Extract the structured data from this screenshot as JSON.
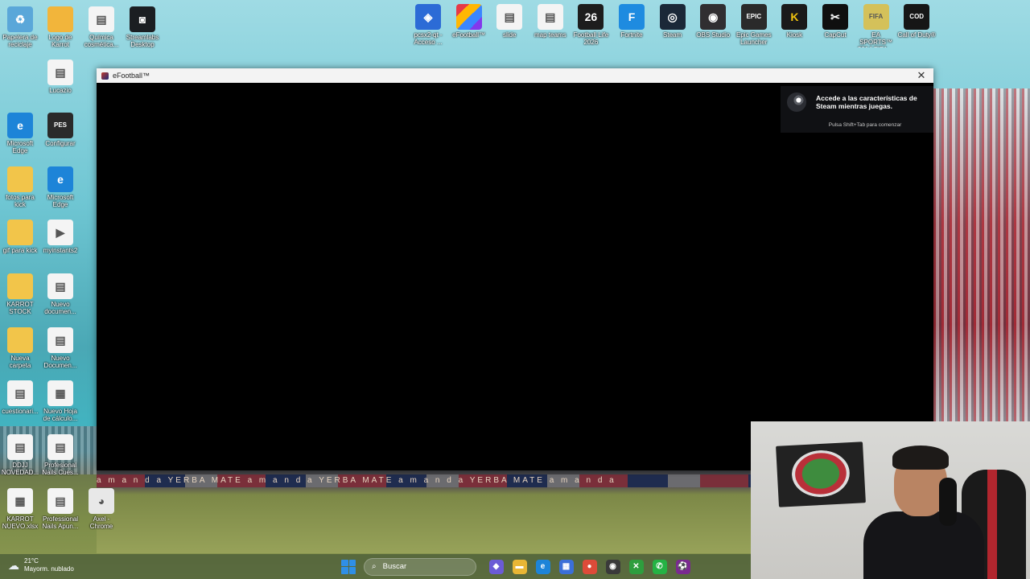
{
  "desktop": {
    "icons_left": [
      {
        "label": "Papelera de reciclaje",
        "icon": "recycle-bin-icon",
        "color": "#5aa7d9"
      },
      {
        "label": "Logo de Karrot",
        "icon": "folder-icon",
        "color": "#f2b53b"
      },
      {
        "label": "Química cosmética...",
        "icon": "document-icon",
        "color": "#f4f4f4"
      },
      {
        "label": "Streamlabs Desktop",
        "icon": "streamlabs-icon",
        "color": "#1b1e22"
      },
      {
        "label": "Lucazio",
        "icon": "document-icon",
        "color": "#f4f4f4"
      },
      {
        "label": "Microsoft Edge",
        "icon": "edge-icon",
        "color": "#1d84d8"
      },
      {
        "label": "Configurar",
        "icon": "pes-settings-icon",
        "color": "#2a2a2a"
      },
      {
        "label": "fotos para kick",
        "icon": "folder-icon",
        "color": "#f2c54a"
      },
      {
        "label": "Microsoft Edge",
        "icon": "edge-icon",
        "color": "#1d84d8"
      },
      {
        "label": "gif para kick",
        "icon": "folder-icon",
        "color": "#f2c54a"
      },
      {
        "label": "myinstants2",
        "icon": "media-icon",
        "color": "#f4f4f4"
      },
      {
        "label": "KARROT STOCK",
        "icon": "folder-icon",
        "color": "#f2c54a"
      },
      {
        "label": "Nuevo documen...",
        "icon": "document-icon",
        "color": "#f4f4f4"
      },
      {
        "label": "Nueva carpeta",
        "icon": "folder-icon",
        "color": "#f2c54a"
      },
      {
        "label": "Nuevo Documen...",
        "icon": "document-icon",
        "color": "#f4f4f4"
      },
      {
        "label": "cuestionari...",
        "icon": "document-icon",
        "color": "#f4f4f4"
      },
      {
        "label": "Nuevo Hoja de cálculo...",
        "icon": "spreadsheet-icon",
        "color": "#f4f4f4"
      },
      {
        "label": "DDJJ NOVEDAD...",
        "icon": "document-icon",
        "color": "#f4f4f4"
      },
      {
        "label": "Profesional Nails Cues...",
        "icon": "document-icon",
        "color": "#f4f4f4"
      },
      {
        "label": "KARROT NUEVO.xlsx",
        "icon": "spreadsheet-icon",
        "color": "#f4f4f4"
      },
      {
        "label": "Professional Nails Apun...",
        "icon": "document-icon",
        "color": "#f4f4f4"
      },
      {
        "label": "Axel - Chrome",
        "icon": "chrome-icon",
        "color": "#e8e8e8"
      }
    ],
    "icons_top": [
      {
        "label": "pcsx2-qt - Acceso ...",
        "icon": "pcsx2-icon",
        "color": "#2c6bd6"
      },
      {
        "label": "eFootball™",
        "icon": "efootball-icon",
        "color": "#8e2fb0"
      },
      {
        "label": "slide",
        "icon": "document-icon",
        "color": "#f4f4f4"
      },
      {
        "label": "map teams",
        "icon": "document-icon",
        "color": "#f4f4f4"
      },
      {
        "label": "Football Life 2026",
        "icon": "football-life-icon",
        "color": "#1d1d1d"
      },
      {
        "label": "Fortnite",
        "icon": "fortnite-icon",
        "color": "#1e8be0"
      },
      {
        "label": "Steam",
        "icon": "steam-icon",
        "color": "#1b2838"
      },
      {
        "label": "OBS Studio",
        "icon": "obs-icon",
        "color": "#302e31"
      },
      {
        "label": "Epic Games Launcher",
        "icon": "epic-games-icon",
        "color": "#2a2a2a"
      },
      {
        "label": "Kiosk",
        "icon": "kiosk-icon",
        "color": "#1a1a1a"
      },
      {
        "label": "CapCut",
        "icon": "capcut-icon",
        "color": "#0f0f0f"
      },
      {
        "label": "EA SPORTS™ 2014 FIFA ...",
        "icon": "fifa-icon",
        "color": "#d4c15a"
      },
      {
        "label": "Call of Duty®",
        "icon": "call-of-duty-icon",
        "color": "#161616"
      }
    ]
  },
  "window": {
    "title": "eFootball™",
    "close_glyph": "✕"
  },
  "steam_overlay": {
    "message": "Accede a las características de Steam mientras juegas.",
    "hint": "Pulsa Shift+Tab para comenzar"
  },
  "ad_board_text": "a m a n d a   YERBA MATE   a m a n d a   YERBA MATE   a m a n d a   YERBA MATE   a m a n d a",
  "taskbar": {
    "temperature": "21°C",
    "weather_desc": "Mayorm. nublado",
    "search_placeholder": "Buscar",
    "apps": [
      {
        "name": "copilot-icon",
        "glyph": "◆",
        "color": "#6b5bd6"
      },
      {
        "name": "file-explorer-icon",
        "glyph": "▬",
        "color": "#e8b635"
      },
      {
        "name": "edge-icon",
        "glyph": "e",
        "color": "#1d84d8"
      },
      {
        "name": "store-icon",
        "glyph": "▦",
        "color": "#3b6fd8"
      },
      {
        "name": "chrome-icon",
        "glyph": "●",
        "color": "#dd4b39"
      },
      {
        "name": "obs-icon",
        "glyph": "◉",
        "color": "#3a3a3a"
      },
      {
        "name": "xbox-icon",
        "glyph": "✕",
        "color": "#2e9e3e"
      },
      {
        "name": "whatsapp-icon",
        "glyph": "✆",
        "color": "#25b244"
      },
      {
        "name": "efootball-icon",
        "glyph": "⚽",
        "color": "#7a2a90"
      }
    ]
  }
}
